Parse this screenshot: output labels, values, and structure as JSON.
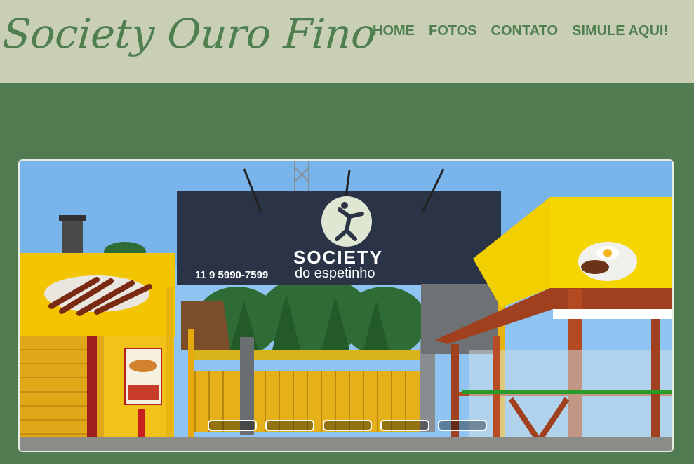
{
  "header": {
    "brand": "Society Ouro Fino",
    "nav": [
      {
        "label": "HOME"
      },
      {
        "label": "FOTOS"
      },
      {
        "label": "CONTATO"
      },
      {
        "label": "SIMULE AQUI!"
      }
    ]
  },
  "slider": {
    "slide_count": 5,
    "active_index": 0,
    "photo": {
      "sign_title": "SOCIETY",
      "sign_subtitle": "do espetinho",
      "sign_phone": "11 9 5990-7599"
    }
  },
  "colors": {
    "header_bg": "#c8cfb5",
    "page_bg": "#517c52",
    "brand_green": "#4f7f4f"
  }
}
